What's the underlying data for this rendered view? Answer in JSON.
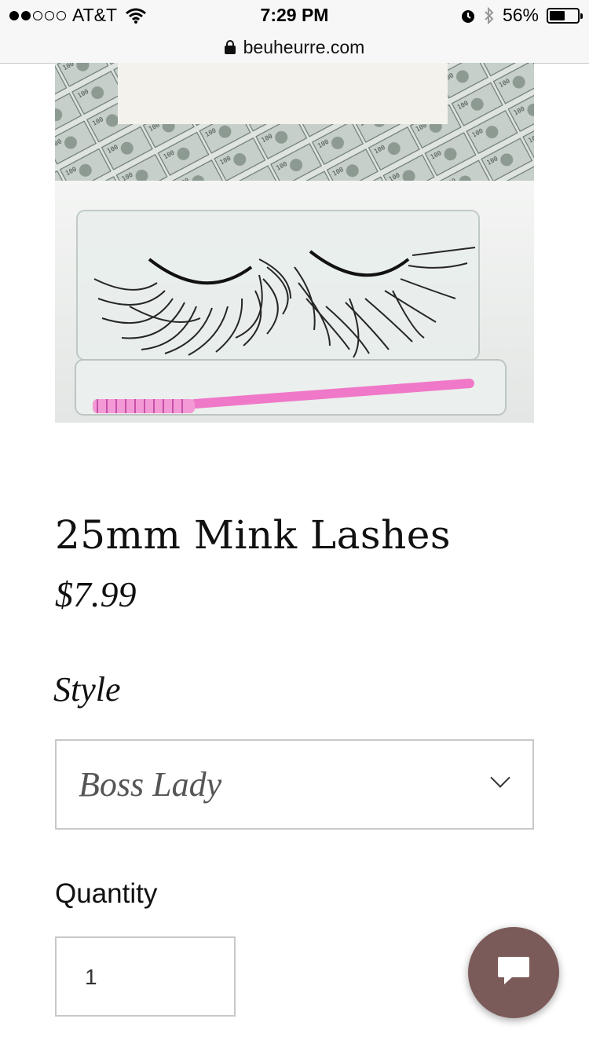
{
  "status_bar": {
    "carrier": "AT&T",
    "time": "7:29 PM",
    "battery": "56%",
    "battery_level": 0.56,
    "signal_bars": 2,
    "signal_total": 5
  },
  "browser": {
    "url": "beuheurre.com"
  },
  "product": {
    "image_icon": "product-photo-mink-lashes",
    "title": "25mm Mink Lashes",
    "price": "$7.99"
  },
  "options": {
    "style_label": "Style",
    "style_value": "Boss Lady",
    "quantity_label": "Quantity",
    "quantity_value": "1"
  },
  "chat": {
    "icon": "chat-bubble-icon",
    "color": "#7b5b59"
  }
}
